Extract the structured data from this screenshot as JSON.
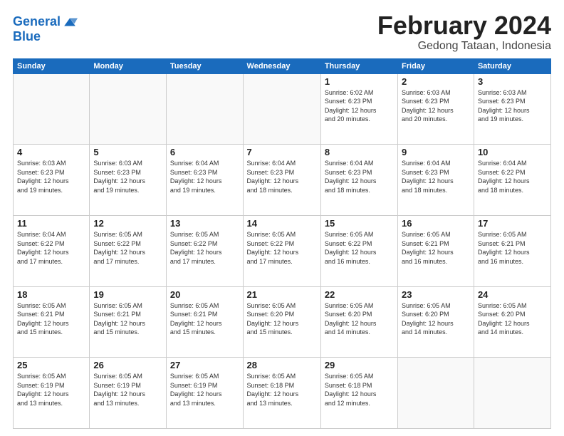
{
  "logo": {
    "line1": "General",
    "line2": "Blue"
  },
  "title": "February 2024",
  "location": "Gedong Tataan, Indonesia",
  "days_of_week": [
    "Sunday",
    "Monday",
    "Tuesday",
    "Wednesday",
    "Thursday",
    "Friday",
    "Saturday"
  ],
  "weeks": [
    [
      {
        "day": "",
        "info": ""
      },
      {
        "day": "",
        "info": ""
      },
      {
        "day": "",
        "info": ""
      },
      {
        "day": "",
        "info": ""
      },
      {
        "day": "1",
        "info": "Sunrise: 6:02 AM\nSunset: 6:23 PM\nDaylight: 12 hours\nand 20 minutes."
      },
      {
        "day": "2",
        "info": "Sunrise: 6:03 AM\nSunset: 6:23 PM\nDaylight: 12 hours\nand 20 minutes."
      },
      {
        "day": "3",
        "info": "Sunrise: 6:03 AM\nSunset: 6:23 PM\nDaylight: 12 hours\nand 19 minutes."
      }
    ],
    [
      {
        "day": "4",
        "info": "Sunrise: 6:03 AM\nSunset: 6:23 PM\nDaylight: 12 hours\nand 19 minutes."
      },
      {
        "day": "5",
        "info": "Sunrise: 6:03 AM\nSunset: 6:23 PM\nDaylight: 12 hours\nand 19 minutes."
      },
      {
        "day": "6",
        "info": "Sunrise: 6:04 AM\nSunset: 6:23 PM\nDaylight: 12 hours\nand 19 minutes."
      },
      {
        "day": "7",
        "info": "Sunrise: 6:04 AM\nSunset: 6:23 PM\nDaylight: 12 hours\nand 18 minutes."
      },
      {
        "day": "8",
        "info": "Sunrise: 6:04 AM\nSunset: 6:23 PM\nDaylight: 12 hours\nand 18 minutes."
      },
      {
        "day": "9",
        "info": "Sunrise: 6:04 AM\nSunset: 6:23 PM\nDaylight: 12 hours\nand 18 minutes."
      },
      {
        "day": "10",
        "info": "Sunrise: 6:04 AM\nSunset: 6:22 PM\nDaylight: 12 hours\nand 18 minutes."
      }
    ],
    [
      {
        "day": "11",
        "info": "Sunrise: 6:04 AM\nSunset: 6:22 PM\nDaylight: 12 hours\nand 17 minutes."
      },
      {
        "day": "12",
        "info": "Sunrise: 6:05 AM\nSunset: 6:22 PM\nDaylight: 12 hours\nand 17 minutes."
      },
      {
        "day": "13",
        "info": "Sunrise: 6:05 AM\nSunset: 6:22 PM\nDaylight: 12 hours\nand 17 minutes."
      },
      {
        "day": "14",
        "info": "Sunrise: 6:05 AM\nSunset: 6:22 PM\nDaylight: 12 hours\nand 17 minutes."
      },
      {
        "day": "15",
        "info": "Sunrise: 6:05 AM\nSunset: 6:22 PM\nDaylight: 12 hours\nand 16 minutes."
      },
      {
        "day": "16",
        "info": "Sunrise: 6:05 AM\nSunset: 6:21 PM\nDaylight: 12 hours\nand 16 minutes."
      },
      {
        "day": "17",
        "info": "Sunrise: 6:05 AM\nSunset: 6:21 PM\nDaylight: 12 hours\nand 16 minutes."
      }
    ],
    [
      {
        "day": "18",
        "info": "Sunrise: 6:05 AM\nSunset: 6:21 PM\nDaylight: 12 hours\nand 15 minutes."
      },
      {
        "day": "19",
        "info": "Sunrise: 6:05 AM\nSunset: 6:21 PM\nDaylight: 12 hours\nand 15 minutes."
      },
      {
        "day": "20",
        "info": "Sunrise: 6:05 AM\nSunset: 6:21 PM\nDaylight: 12 hours\nand 15 minutes."
      },
      {
        "day": "21",
        "info": "Sunrise: 6:05 AM\nSunset: 6:20 PM\nDaylight: 12 hours\nand 15 minutes."
      },
      {
        "day": "22",
        "info": "Sunrise: 6:05 AM\nSunset: 6:20 PM\nDaylight: 12 hours\nand 14 minutes."
      },
      {
        "day": "23",
        "info": "Sunrise: 6:05 AM\nSunset: 6:20 PM\nDaylight: 12 hours\nand 14 minutes."
      },
      {
        "day": "24",
        "info": "Sunrise: 6:05 AM\nSunset: 6:20 PM\nDaylight: 12 hours\nand 14 minutes."
      }
    ],
    [
      {
        "day": "25",
        "info": "Sunrise: 6:05 AM\nSunset: 6:19 PM\nDaylight: 12 hours\nand 13 minutes."
      },
      {
        "day": "26",
        "info": "Sunrise: 6:05 AM\nSunset: 6:19 PM\nDaylight: 12 hours\nand 13 minutes."
      },
      {
        "day": "27",
        "info": "Sunrise: 6:05 AM\nSunset: 6:19 PM\nDaylight: 12 hours\nand 13 minutes."
      },
      {
        "day": "28",
        "info": "Sunrise: 6:05 AM\nSunset: 6:18 PM\nDaylight: 12 hours\nand 13 minutes."
      },
      {
        "day": "29",
        "info": "Sunrise: 6:05 AM\nSunset: 6:18 PM\nDaylight: 12 hours\nand 12 minutes."
      },
      {
        "day": "",
        "info": ""
      },
      {
        "day": "",
        "info": ""
      }
    ]
  ]
}
